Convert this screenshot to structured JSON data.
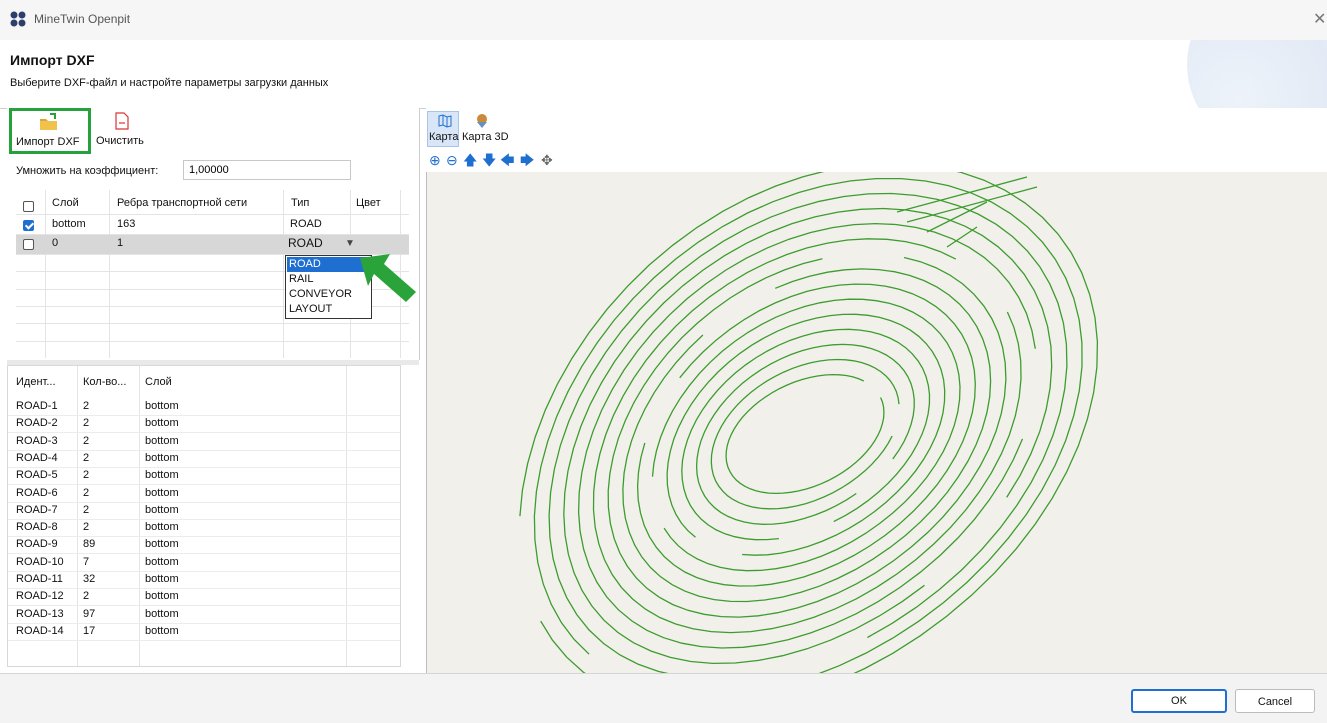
{
  "window": {
    "title": "MineTwin Openpit"
  },
  "header": {
    "title": "Импорт DXF",
    "subtitle": "Выберите DXF-файл и настройте параметры загрузки данных"
  },
  "toolbar": {
    "import_label": "Импорт DXF",
    "clear_label": "Очистить"
  },
  "multiplier": {
    "label": "Умножить на коэффициент:",
    "value": "1,00000"
  },
  "layers_table": {
    "columns": [
      "Слой",
      "Ребра транспортной сети",
      "Тип",
      "Цвет"
    ],
    "rows": [
      {
        "checked": true,
        "layer": "bottom",
        "edges": "163",
        "type": "ROAD"
      },
      {
        "checked": false,
        "layer": "0",
        "edges": "1",
        "type": "ROAD"
      }
    ],
    "type_options": [
      "ROAD",
      "RAIL",
      "CONVEYOR",
      "LAYOUT"
    ],
    "selected_option": "ROAD"
  },
  "objects_table": {
    "columns": [
      "Идент...",
      "Кол-во...",
      "Слой"
    ],
    "rows": [
      {
        "id": "ROAD-1",
        "count": "2",
        "layer": "bottom"
      },
      {
        "id": "ROAD-2",
        "count": "2",
        "layer": "bottom"
      },
      {
        "id": "ROAD-3",
        "count": "2",
        "layer": "bottom"
      },
      {
        "id": "ROAD-4",
        "count": "2",
        "layer": "bottom"
      },
      {
        "id": "ROAD-5",
        "count": "2",
        "layer": "bottom"
      },
      {
        "id": "ROAD-6",
        "count": "2",
        "layer": "bottom"
      },
      {
        "id": "ROAD-7",
        "count": "2",
        "layer": "bottom"
      },
      {
        "id": "ROAD-8",
        "count": "2",
        "layer": "bottom"
      },
      {
        "id": "ROAD-9",
        "count": "89",
        "layer": "bottom"
      },
      {
        "id": "ROAD-10",
        "count": "7",
        "layer": "bottom"
      },
      {
        "id": "ROAD-11",
        "count": "32",
        "layer": "bottom"
      },
      {
        "id": "ROAD-12",
        "count": "2",
        "layer": "bottom"
      },
      {
        "id": "ROAD-13",
        "count": "97",
        "layer": "bottom"
      },
      {
        "id": "ROAD-14",
        "count": "17",
        "layer": "bottom"
      }
    ]
  },
  "map": {
    "tabs": [
      "Карта",
      "Карта 3D"
    ],
    "active_tab": "Карта",
    "line_color": "#3d9c2e",
    "background": "#f2f0eb",
    "nav_icons": [
      "zoom-in-icon",
      "zoom-out-icon",
      "arrow-up-icon",
      "arrow-down-icon",
      "arrow-left-icon",
      "arrow-right-icon",
      "pan-icon"
    ]
  },
  "footer": {
    "ok_label": "OK",
    "cancel_label": "Cancel"
  },
  "colors": {
    "accent": "#1f6fd1",
    "highlight_green": "#27a13b"
  }
}
